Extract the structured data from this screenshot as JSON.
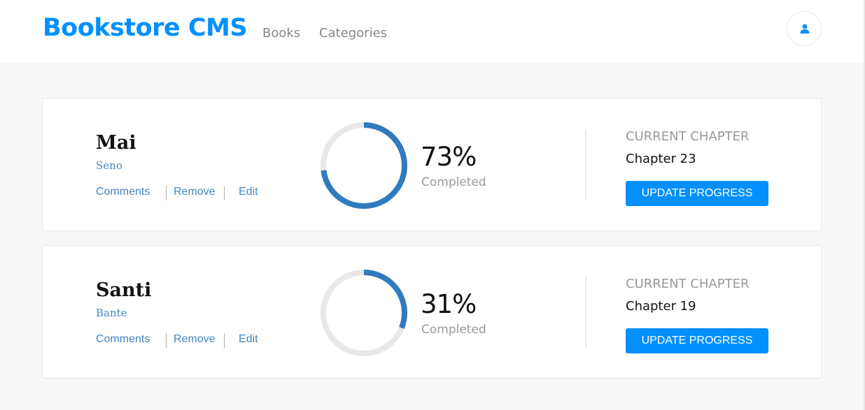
{
  "header": {
    "brand": "Bookstore CMS",
    "nav": [
      "Books",
      "Categories"
    ],
    "user_icon": "user-icon"
  },
  "colors": {
    "brand": "#0290ff",
    "progress": "#307bbe",
    "track": "#e8e8e8",
    "link": "#4386bf"
  },
  "books": [
    {
      "title": "Mai",
      "author": "Seno",
      "actions": [
        "Comments",
        "Remove",
        "Edit"
      ],
      "progress": 0.73,
      "percent_label": "73%",
      "completed_label": "Completed",
      "chapter_label": "CURRENT CHAPTER",
      "chapter": "Chapter 23",
      "update_label": "UPDATE PROGRESS"
    },
    {
      "title": "Santi",
      "author": "Bante",
      "actions": [
        "Comments",
        "Remove",
        "Edit"
      ],
      "progress": 0.31,
      "percent_label": "31%",
      "completed_label": "Completed",
      "chapter_label": "CURRENT CHAPTER",
      "chapter": "Chapter 19",
      "update_label": "UPDATE PROGRESS"
    }
  ]
}
